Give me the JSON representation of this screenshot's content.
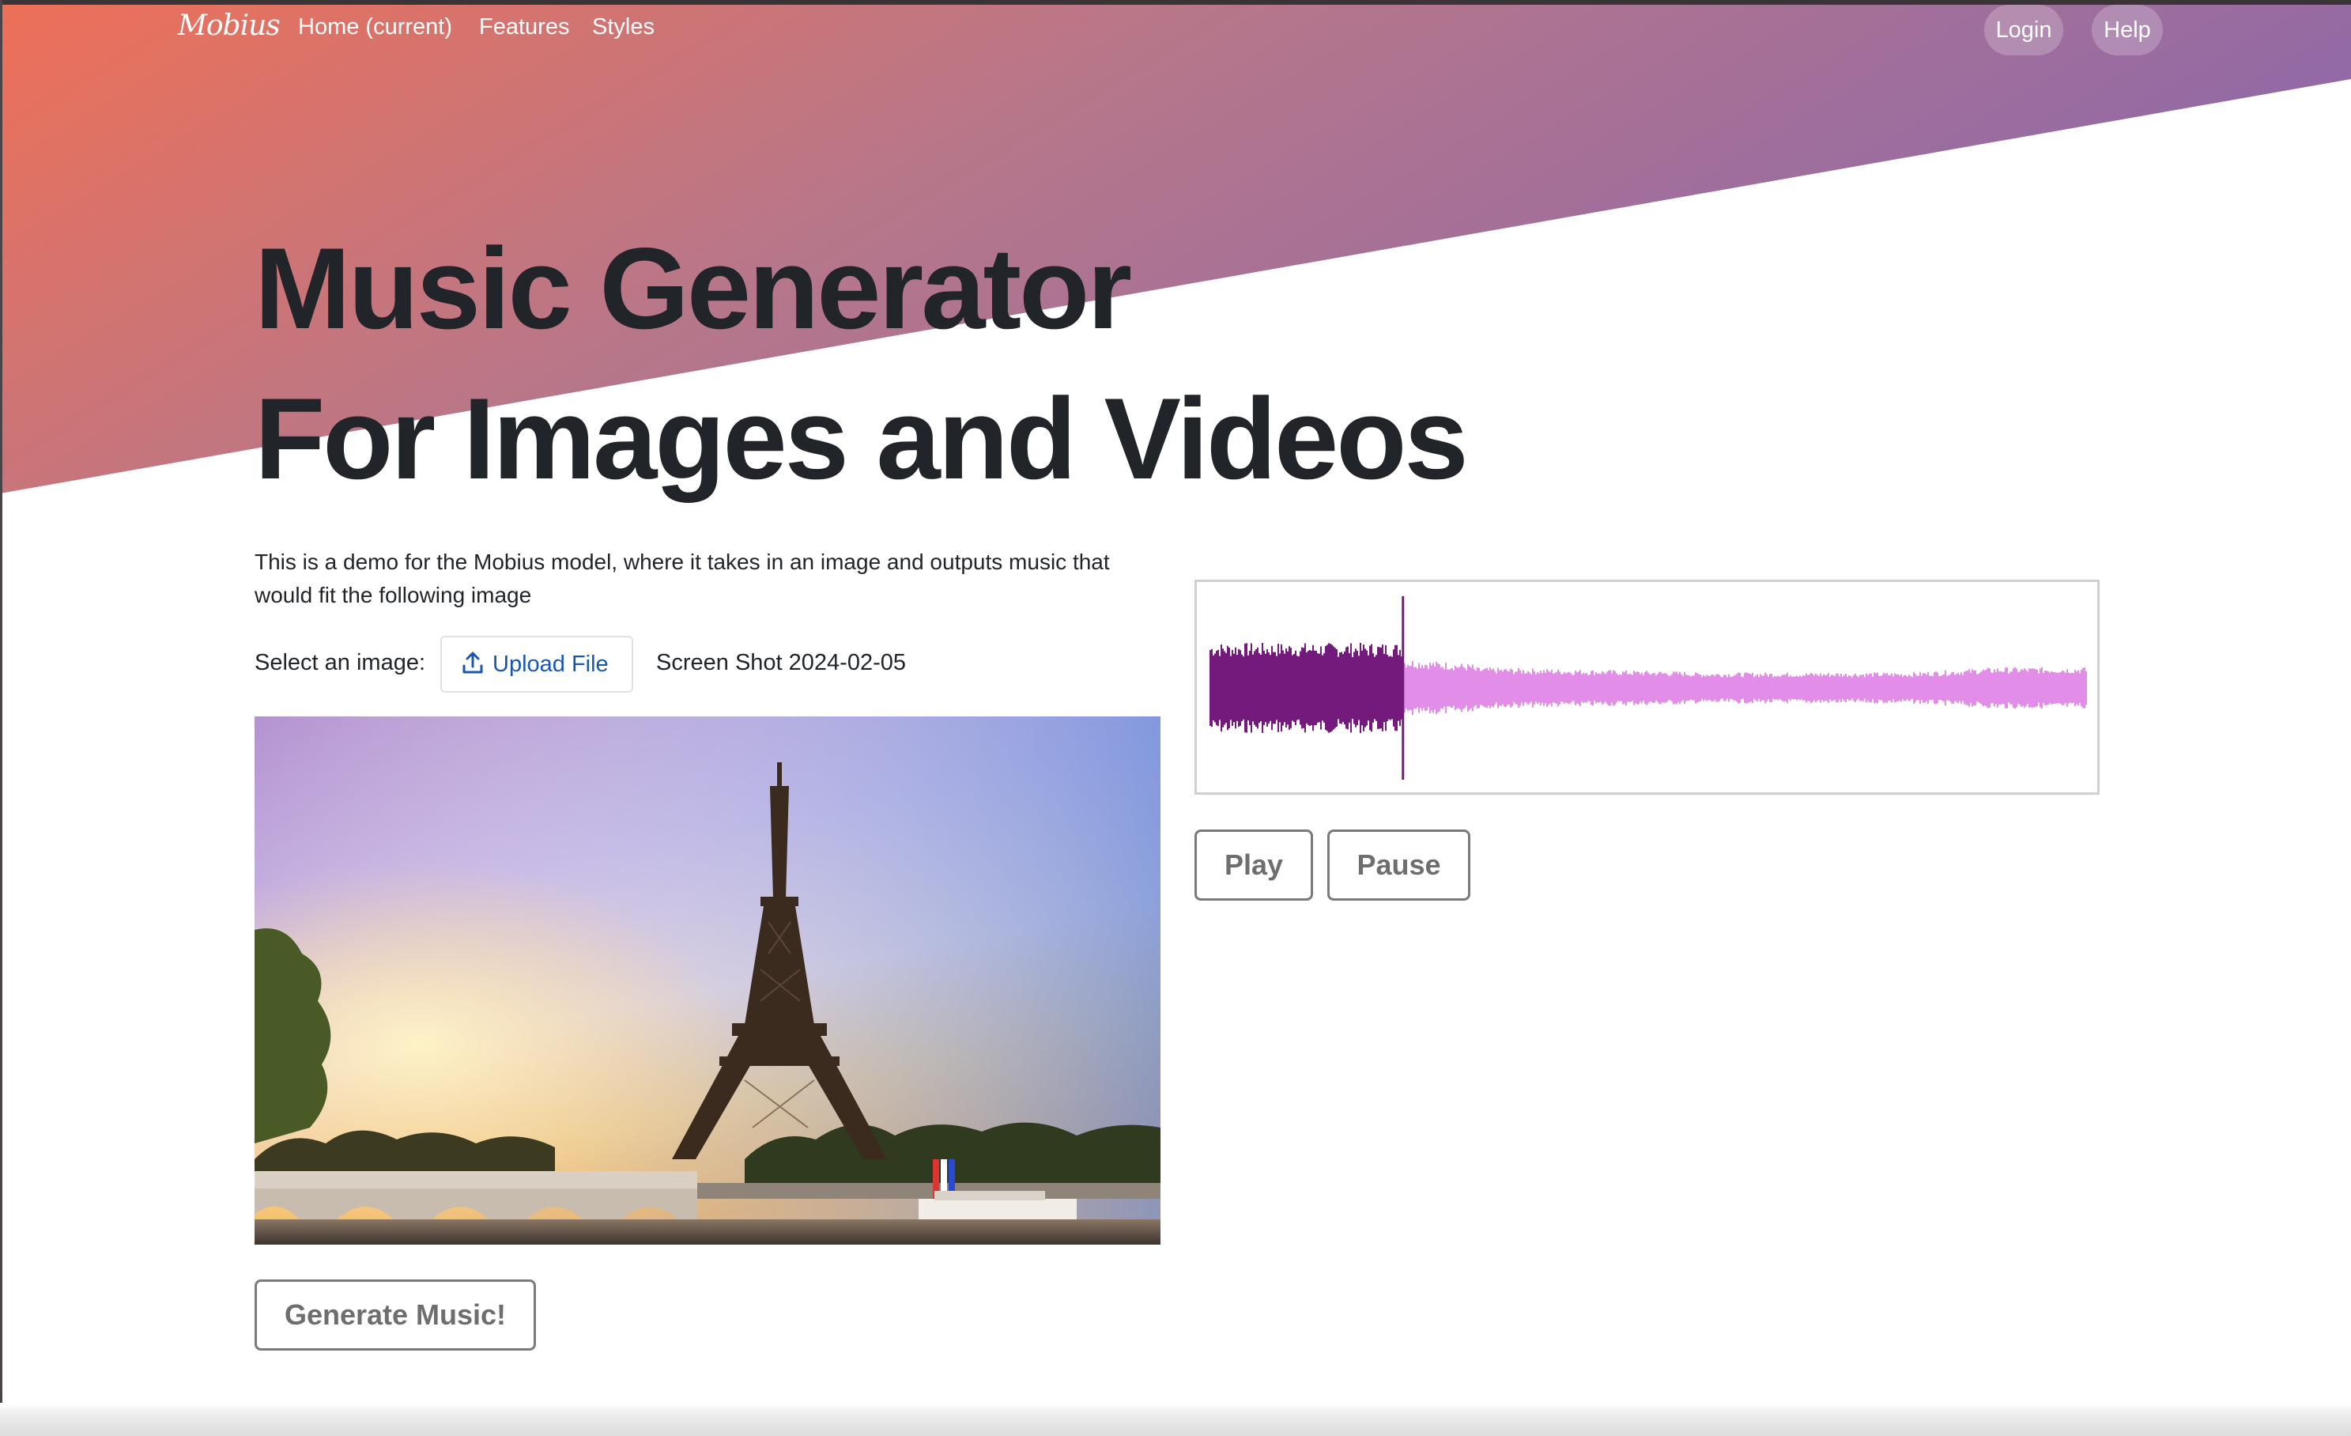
{
  "nav": {
    "brand": "Mobius",
    "links": [
      {
        "label": "Home (current)"
      },
      {
        "label": "Features"
      },
      {
        "label": "Styles"
      }
    ],
    "login_label": "Login",
    "help_label": "Help"
  },
  "hero": {
    "title_line1": "Music Generator",
    "title_line2": "For Images and Videos",
    "gradient_start": "#ee7057",
    "gradient_end": "#8e68a9"
  },
  "main": {
    "description": "This is a demo for the Mobius model, where it takes in an image and outputs music that would fit the following image",
    "select_label": "Select an image:",
    "upload_label": "Upload File",
    "upload_icon": "upload-icon",
    "file_name": "Screen Shot 2024-02-05",
    "generate_label": "Generate Music!"
  },
  "player": {
    "play_label": "Play",
    "pause_label": "Pause",
    "progress_fraction": 0.22,
    "played_color": "#741a7c",
    "unplayed_color": "#e28ee9"
  }
}
